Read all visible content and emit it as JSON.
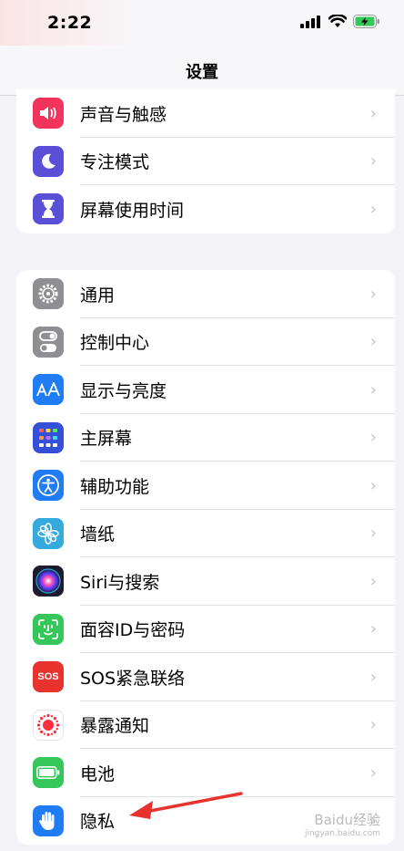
{
  "status_bar": {
    "time": "2:22"
  },
  "nav": {
    "title": "设置"
  },
  "group1": [
    {
      "label": "声音与触感",
      "icon": "speaker-icon",
      "color": "#f0345b"
    },
    {
      "label": "专注模式",
      "icon": "moon-icon",
      "color": "#5a4fd6"
    },
    {
      "label": "屏幕使用时间",
      "icon": "hourglass-icon",
      "color": "#5a4fd6"
    }
  ],
  "group2": [
    {
      "label": "通用",
      "icon": "gear-icon",
      "color": "#8e8e93"
    },
    {
      "label": "控制中心",
      "icon": "toggle-icon",
      "color": "#8e8e93"
    },
    {
      "label": "显示与亮度",
      "icon": "text-size-icon",
      "color": "#1f7cf2"
    },
    {
      "label": "主屏幕",
      "icon": "home-grid-icon",
      "color": "#3450d8"
    },
    {
      "label": "辅助功能",
      "icon": "accessibility-icon",
      "color": "#1f7cf2"
    },
    {
      "label": "墙纸",
      "icon": "flower-icon",
      "color": "#35aadc"
    },
    {
      "label": "Siri与搜索",
      "icon": "siri-icon",
      "color": "#1c1c2e"
    },
    {
      "label": "面容ID与密码",
      "icon": "face-id-icon",
      "color": "#35c759"
    },
    {
      "label": "SOS紧急联络",
      "icon": "sos-icon",
      "color": "#e8322d",
      "badge": "SOS"
    },
    {
      "label": "暴露通知",
      "icon": "exposure-icon",
      "color": "#ffffff"
    },
    {
      "label": "电池",
      "icon": "battery-icon",
      "color": "#35c759"
    },
    {
      "label": "隐私",
      "icon": "hand-icon",
      "color": "#1f7cf2"
    }
  ],
  "chevron": "›",
  "watermark": {
    "text": "Baidu经验",
    "sub": "jingyan.baidu.com"
  },
  "colors": {
    "annotation_arrow": "#e8322d"
  }
}
